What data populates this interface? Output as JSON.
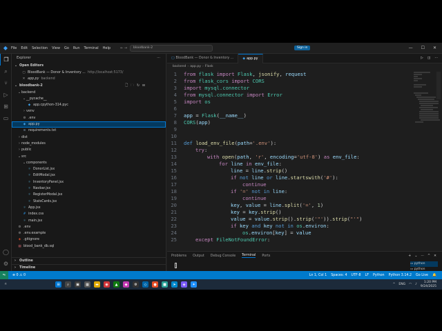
{
  "title_bar": {
    "menu": [
      "File",
      "Edit",
      "Selection",
      "View",
      "Go",
      "Run",
      "Terminal",
      "Help"
    ],
    "search_text": "bloodbank-2",
    "signin_label": "Sign in"
  },
  "sidebar": {
    "title": "Explorer",
    "open_editors_label": "Open Editors",
    "open_editors": [
      {
        "name": "BloodBank — Donor & Inventory ...",
        "hint": "http://localhost:5173/"
      },
      {
        "name": "app.py",
        "hint": "backend"
      }
    ],
    "project_label": "bloodbank-2",
    "tree": [
      {
        "name": "backend",
        "type": "folder",
        "depth": 0,
        "open": true
      },
      {
        "name": "__pycache__",
        "type": "folder",
        "depth": 1,
        "open": true
      },
      {
        "name": "app.cpython-314.pyc",
        "type": "pyc",
        "depth": 2
      },
      {
        "name": "venv",
        "type": "folder",
        "depth": 1,
        "open": false
      },
      {
        "name": ".env",
        "type": "cfg",
        "depth": 1
      },
      {
        "name": "app.py",
        "type": "py",
        "depth": 1,
        "selected": true
      },
      {
        "name": "requirements.txt",
        "type": "txt",
        "depth": 1
      },
      {
        "name": "dist",
        "type": "folder",
        "depth": 0,
        "open": false
      },
      {
        "name": "node_modules",
        "type": "folder",
        "depth": 0,
        "open": false
      },
      {
        "name": "public",
        "type": "folder",
        "depth": 0,
        "open": false
      },
      {
        "name": "src",
        "type": "folder",
        "depth": 0,
        "open": true
      },
      {
        "name": "components",
        "type": "folder",
        "depth": 1,
        "open": true
      },
      {
        "name": "DonorList.jsx",
        "type": "jsx",
        "depth": 2
      },
      {
        "name": "EditModal.jsx",
        "type": "jsx",
        "depth": 2
      },
      {
        "name": "InventoryPanel.jsx",
        "type": "jsx",
        "depth": 2
      },
      {
        "name": "Navbar.jsx",
        "type": "jsx",
        "depth": 2
      },
      {
        "name": "RegisterModal.jsx",
        "type": "jsx",
        "depth": 2
      },
      {
        "name": "StatsCards.jsx",
        "type": "jsx",
        "depth": 2
      },
      {
        "name": "App.jsx",
        "type": "jsx",
        "depth": 1
      },
      {
        "name": "index.css",
        "type": "css",
        "depth": 1
      },
      {
        "name": "main.jsx",
        "type": "jsx",
        "depth": 1
      },
      {
        "name": ".env",
        "type": "cfg",
        "depth": 0
      },
      {
        "name": ".env.example",
        "type": "cfg",
        "depth": 0
      },
      {
        "name": ".gitignore",
        "type": "git",
        "depth": 0
      },
      {
        "name": "blood_bank_db.sql",
        "type": "sql",
        "depth": 0
      }
    ],
    "outline_label": "Outline",
    "timeline_label": "Timeline"
  },
  "editor": {
    "tabs": [
      {
        "label": "BloodBank — Donor & Inventory ...",
        "active": false
      },
      {
        "label": "app.py",
        "active": true
      }
    ],
    "breadcrumb": [
      "backend",
      "app.py",
      "Flask"
    ],
    "lines": [
      {
        "n": "1",
        "indent": 0,
        "tokens": [
          [
            "kw",
            "from "
          ],
          [
            "cls",
            "flask "
          ],
          [
            "kw",
            "import "
          ],
          [
            "cls",
            "Flask"
          ],
          [
            "txt",
            ", "
          ],
          [
            "fn",
            "jsonify"
          ],
          [
            "txt",
            ", "
          ],
          [
            "var",
            "request"
          ]
        ]
      },
      {
        "n": "2",
        "indent": 0,
        "tokens": [
          [
            "kw",
            "from "
          ],
          [
            "cls",
            "flask_cors "
          ],
          [
            "kw",
            "import "
          ],
          [
            "cls",
            "CORS"
          ]
        ]
      },
      {
        "n": "3",
        "indent": 0,
        "tokens": [
          [
            "kw",
            "import "
          ],
          [
            "cls",
            "mysql.connector"
          ]
        ]
      },
      {
        "n": "4",
        "indent": 0,
        "tokens": [
          [
            "kw",
            "from "
          ],
          [
            "cls",
            "mysql.connector "
          ],
          [
            "kw",
            "import "
          ],
          [
            "cls",
            "Error"
          ]
        ]
      },
      {
        "n": "5",
        "indent": 0,
        "tokens": [
          [
            "kw",
            "import "
          ],
          [
            "cls",
            "os"
          ]
        ]
      },
      {
        "n": "6",
        "indent": 0,
        "tokens": []
      },
      {
        "n": "7",
        "indent": 0,
        "tokens": [
          [
            "var",
            "app "
          ],
          [
            "txt",
            "= "
          ],
          [
            "cls",
            "Flask"
          ],
          [
            "txt",
            "("
          ],
          [
            "var",
            "__name__"
          ],
          [
            "txt",
            ")"
          ]
        ]
      },
      {
        "n": "8",
        "indent": 0,
        "tokens": [
          [
            "cls",
            "CORS"
          ],
          [
            "txt",
            "("
          ],
          [
            "var",
            "app"
          ],
          [
            "txt",
            ")"
          ]
        ]
      },
      {
        "n": "9",
        "indent": 0,
        "tokens": []
      },
      {
        "n": "10",
        "indent": 0,
        "tokens": []
      },
      {
        "n": "11",
        "indent": 0,
        "tokens": [
          [
            "kw2",
            "def "
          ],
          [
            "fn",
            "load_env_file"
          ],
          [
            "txt",
            "("
          ],
          [
            "var",
            "path"
          ],
          [
            "txt",
            "="
          ],
          [
            "str",
            "'.env'"
          ],
          [
            "txt",
            "):"
          ]
        ]
      },
      {
        "n": "12",
        "indent": 1,
        "tokens": [
          [
            "kw",
            "try"
          ],
          [
            "txt",
            ":"
          ]
        ]
      },
      {
        "n": "13",
        "indent": 2,
        "tokens": [
          [
            "kw",
            "with "
          ],
          [
            "fn",
            "open"
          ],
          [
            "txt",
            "("
          ],
          [
            "var",
            "path"
          ],
          [
            "txt",
            ", "
          ],
          [
            "str",
            "'r'"
          ],
          [
            "txt",
            ", "
          ],
          [
            "var",
            "encoding"
          ],
          [
            "txt",
            "="
          ],
          [
            "str",
            "'utf-8'"
          ],
          [
            "txt",
            ") "
          ],
          [
            "kw",
            "as "
          ],
          [
            "var",
            "env_file"
          ],
          [
            "txt",
            ":"
          ]
        ]
      },
      {
        "n": "14",
        "indent": 3,
        "tokens": [
          [
            "kw",
            "for "
          ],
          [
            "var",
            "line "
          ],
          [
            "kw",
            "in "
          ],
          [
            "var",
            "env_file"
          ],
          [
            "txt",
            ":"
          ]
        ]
      },
      {
        "n": "15",
        "indent": 4,
        "tokens": [
          [
            "var",
            "line "
          ],
          [
            "txt",
            "= "
          ],
          [
            "var",
            "line"
          ],
          [
            "txt",
            "."
          ],
          [
            "fn",
            "strip"
          ],
          [
            "txt",
            "()"
          ]
        ]
      },
      {
        "n": "16",
        "indent": 4,
        "tokens": [
          [
            "kw",
            "if "
          ],
          [
            "kw2",
            "not "
          ],
          [
            "var",
            "line "
          ],
          [
            "kw2",
            "or "
          ],
          [
            "var",
            "line"
          ],
          [
            "txt",
            "."
          ],
          [
            "fn",
            "startswith"
          ],
          [
            "txt",
            "("
          ],
          [
            "str",
            "'#'"
          ],
          [
            "txt",
            "):"
          ]
        ]
      },
      {
        "n": "17",
        "indent": 5,
        "tokens": [
          [
            "kw",
            "continue"
          ]
        ]
      },
      {
        "n": "18",
        "indent": 4,
        "tokens": [
          [
            "kw",
            "if "
          ],
          [
            "str",
            "'=' "
          ],
          [
            "kw2",
            "not in "
          ],
          [
            "var",
            "line"
          ],
          [
            "txt",
            ":"
          ]
        ]
      },
      {
        "n": "19",
        "indent": 5,
        "tokens": [
          [
            "kw",
            "continue"
          ]
        ]
      },
      {
        "n": "20",
        "indent": 4,
        "tokens": [
          [
            "var",
            "key"
          ],
          [
            "txt",
            ", "
          ],
          [
            "var",
            "value "
          ],
          [
            "txt",
            "= "
          ],
          [
            "var",
            "line"
          ],
          [
            "txt",
            "."
          ],
          [
            "fn",
            "split"
          ],
          [
            "txt",
            "("
          ],
          [
            "str",
            "'='"
          ],
          [
            "txt",
            ", "
          ],
          [
            "num",
            "1"
          ],
          [
            "txt",
            ")"
          ]
        ]
      },
      {
        "n": "21",
        "indent": 4,
        "tokens": [
          [
            "var",
            "key "
          ],
          [
            "txt",
            "= "
          ],
          [
            "var",
            "key"
          ],
          [
            "txt",
            "."
          ],
          [
            "fn",
            "strip"
          ],
          [
            "txt",
            "()"
          ]
        ]
      },
      {
        "n": "22",
        "indent": 4,
        "tokens": [
          [
            "var",
            "value "
          ],
          [
            "txt",
            "= "
          ],
          [
            "var",
            "value"
          ],
          [
            "txt",
            "."
          ],
          [
            "fn",
            "strip"
          ],
          [
            "txt",
            "()."
          ],
          [
            "fn",
            "strip"
          ],
          [
            "txt",
            "("
          ],
          [
            "str",
            "'\"'"
          ],
          [
            "txt",
            "))."
          ],
          [
            "fn",
            "strip"
          ],
          [
            "txt",
            "("
          ],
          [
            "str",
            "\"'\""
          ],
          [
            "txt",
            ")"
          ]
        ]
      },
      {
        "n": "23",
        "indent": 4,
        "tokens": [
          [
            "kw",
            "if "
          ],
          [
            "var",
            "key "
          ],
          [
            "kw2",
            "and "
          ],
          [
            "var",
            "key "
          ],
          [
            "kw2",
            "not in "
          ],
          [
            "cls",
            "os"
          ],
          [
            "txt",
            "."
          ],
          [
            "var",
            "environ"
          ],
          [
            "txt",
            ":"
          ]
        ]
      },
      {
        "n": "24",
        "indent": 5,
        "tokens": [
          [
            "cls",
            "os"
          ],
          [
            "txt",
            "."
          ],
          [
            "var",
            "environ"
          ],
          [
            "txt",
            "["
          ],
          [
            "var",
            "key"
          ],
          [
            "txt",
            "] = "
          ],
          [
            "var",
            "value"
          ]
        ]
      },
      {
        "n": "25",
        "indent": 1,
        "tokens": [
          [
            "kw",
            "except "
          ],
          [
            "cls",
            "FileNotFoundError"
          ],
          [
            "txt",
            ":"
          ]
        ]
      }
    ]
  },
  "panel": {
    "tabs": [
      "Problems",
      "Output",
      "Debug Console",
      "Terminal",
      "Ports"
    ],
    "active_tab": "Terminal",
    "terminals": [
      "python",
      "python"
    ]
  },
  "status_bar": {
    "errors": "0",
    "warnings": "0",
    "cursor": "Ln 1, Col 1",
    "spaces": "Spaces: 4",
    "encoding": "UTF-8",
    "eol": "LF",
    "language": "Python",
    "interpreter": "Python 3.14.2",
    "golive": "Go Live"
  },
  "taskbar": {
    "weather": "☼",
    "lang": "ENG",
    "time": "1:20 PM",
    "date": "9/24/2025"
  }
}
